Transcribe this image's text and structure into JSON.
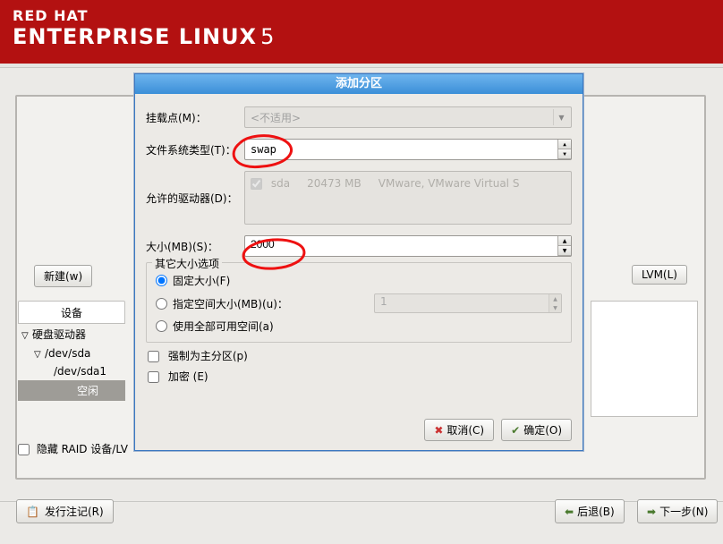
{
  "header": {
    "line1": "RED HAT",
    "line2": "ENTERPRISE LINUX",
    "ver": "5"
  },
  "main": {
    "new_btn": "新建(w)",
    "lvm_btn": "LVM(L)",
    "col_device": "设备",
    "tree": {
      "root": "硬盘驱动器",
      "child1": "/dev/sda",
      "child2a": "/dev/sda1",
      "child2b": "空闲"
    },
    "hide_raid": "隐藏 RAID 设备/LV"
  },
  "nav": {
    "release": "发行注记(R)",
    "back": "后退(B)",
    "next": "下一步(N)"
  },
  "dialog": {
    "title": "添加分区",
    "mount_label": "挂载点(M)：",
    "mount_placeholder": "<不适用>",
    "fs_label": "文件系统类型(T)：",
    "fs_value": "swap",
    "drives_label": "允许的驱动器(D)：",
    "drive_line": {
      "dev": "sda",
      "size": "20473 MB",
      "desc": "VMware, VMware Virtual S"
    },
    "size_label": "大小(MB)(S)：",
    "size_value": "2000",
    "other_legend": "其它大小选项",
    "fixed": "固定大小(F)",
    "specify": "指定空间大小(MB)(u)：",
    "specify_val": "1",
    "fill": "使用全部可用空间(a)",
    "primary": "强制为主分区(p)",
    "encrypt": "加密 (E)",
    "cancel": "取消(C)",
    "ok": "确定(O)"
  }
}
